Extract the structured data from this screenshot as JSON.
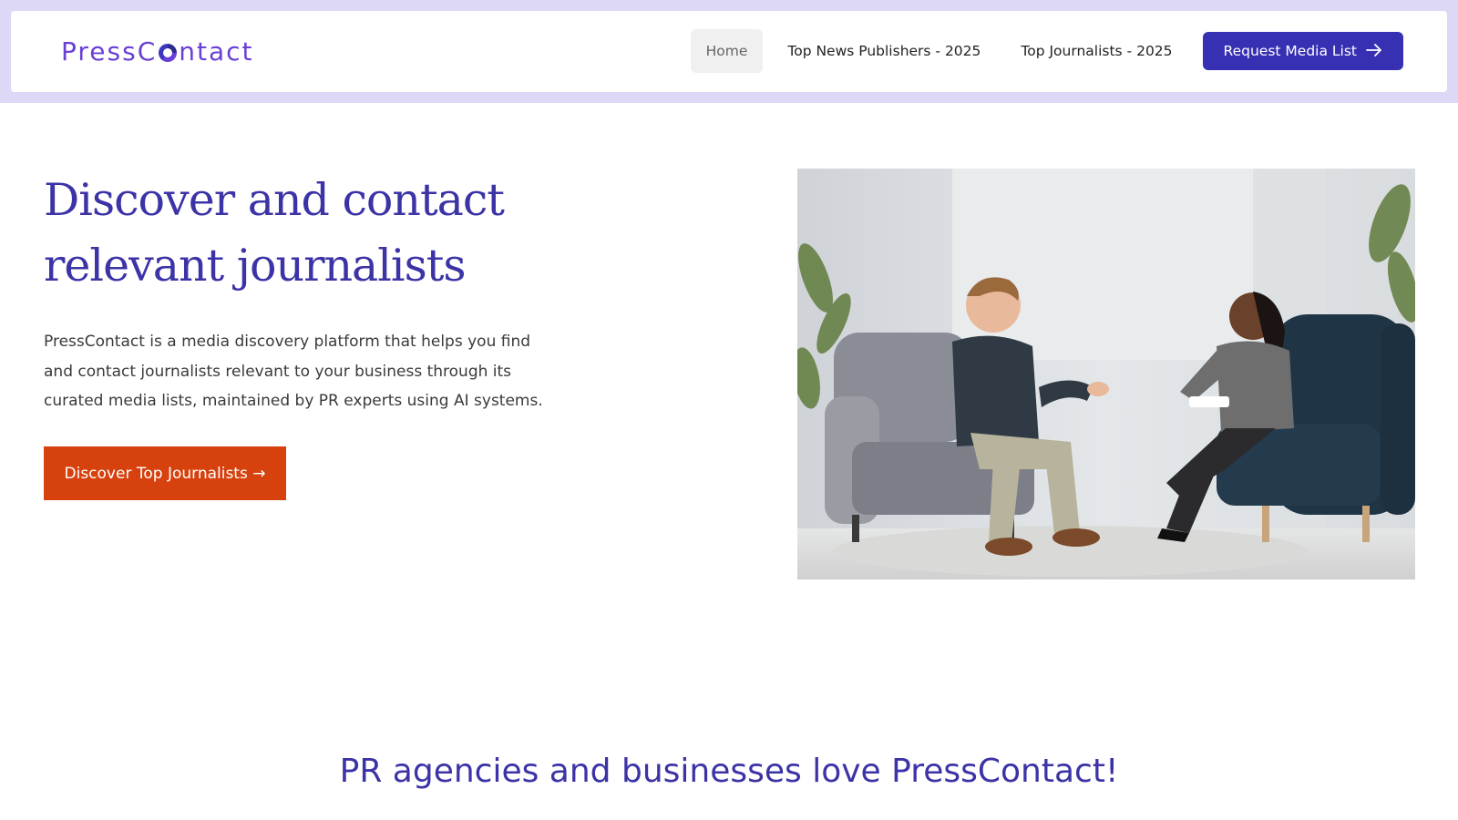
{
  "brand": {
    "name_part1": "PressC",
    "name_part2": "ntact"
  },
  "nav": {
    "items": [
      {
        "label": "Home",
        "active": true
      },
      {
        "label": "Top News Publishers - 2025",
        "active": false
      },
      {
        "label": "Top Journalists - 2025",
        "active": false
      }
    ],
    "cta_label": "Request Media List",
    "cta_icon": "arrow-right-icon"
  },
  "hero": {
    "title_line1": "Discover and contact",
    "title_line2": "relevant journalists",
    "description": "PressContact is a media discovery platform that helps you find and contact journalists relevant to your business through its curated media lists, maintained by PR experts using AI systems.",
    "button_label": "Discover Top Journalists →"
  },
  "testimonials": {
    "heading": "PR agencies and businesses love PressContact!"
  },
  "colors": {
    "accent": "#3b33a6",
    "cta_nav": "#3730b3",
    "cta_hero": "#d6410e",
    "top_band": "#dcd8f6"
  }
}
